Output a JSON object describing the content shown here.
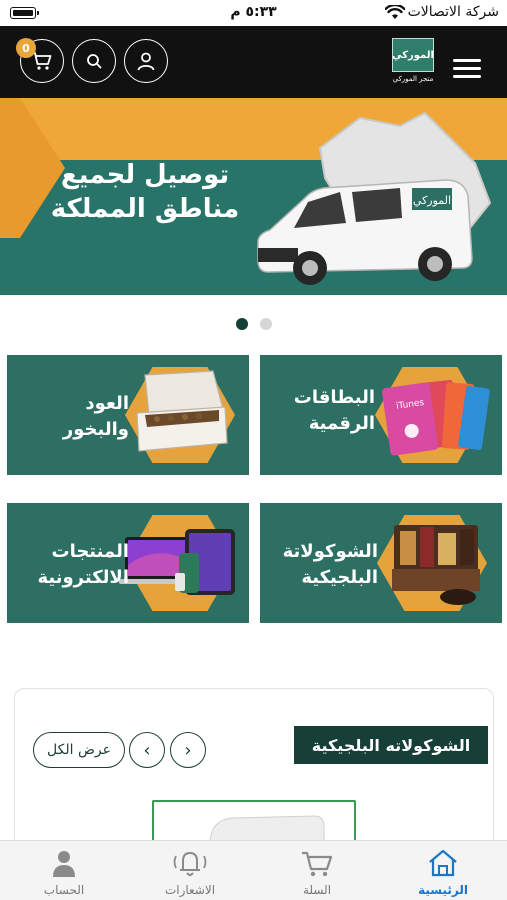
{
  "status_bar": {
    "time": "٥:٣٣ م",
    "carrier": "شركة الاتصالات"
  },
  "header": {
    "cart_count": "0",
    "logo_text": "الموركي",
    "logo_subtext": "متجر الموركي"
  },
  "banner": {
    "line1": "توصيل لجميع",
    "line2": "مناطق المملكة",
    "van_brand": "الموركي"
  },
  "carousel": {
    "active_index": 0,
    "count": 2
  },
  "categories": [
    {
      "line1": "البطاقات",
      "line2": "الرقمية"
    },
    {
      "line1": "العود",
      "line2": "والبخور"
    },
    {
      "line1": "الشوكولاتة",
      "line2": "البلجيكية"
    },
    {
      "line1": "المنتجات",
      "line2": "الالكترونية"
    }
  ],
  "gift_card_text": "iTunes",
  "section": {
    "title": "الشوكولاته البلجيكية",
    "view_all": "عرض الكل",
    "prev": "‹",
    "next": "›"
  },
  "tabs": [
    {
      "label": "الرئيسية",
      "icon": "home-icon",
      "active": true
    },
    {
      "label": "السلة",
      "icon": "cart-icon",
      "active": false
    },
    {
      "label": "الاشعارات",
      "icon": "bell-icon",
      "active": false
    },
    {
      "label": "الحساب",
      "icon": "person-icon",
      "active": false
    }
  ],
  "colors": {
    "header_bg": "#111111",
    "brand_green": "#2e6f64",
    "accent_orange": "#e6a33c",
    "active_tab": "#1a76c9",
    "badge": "#e8a63b"
  }
}
